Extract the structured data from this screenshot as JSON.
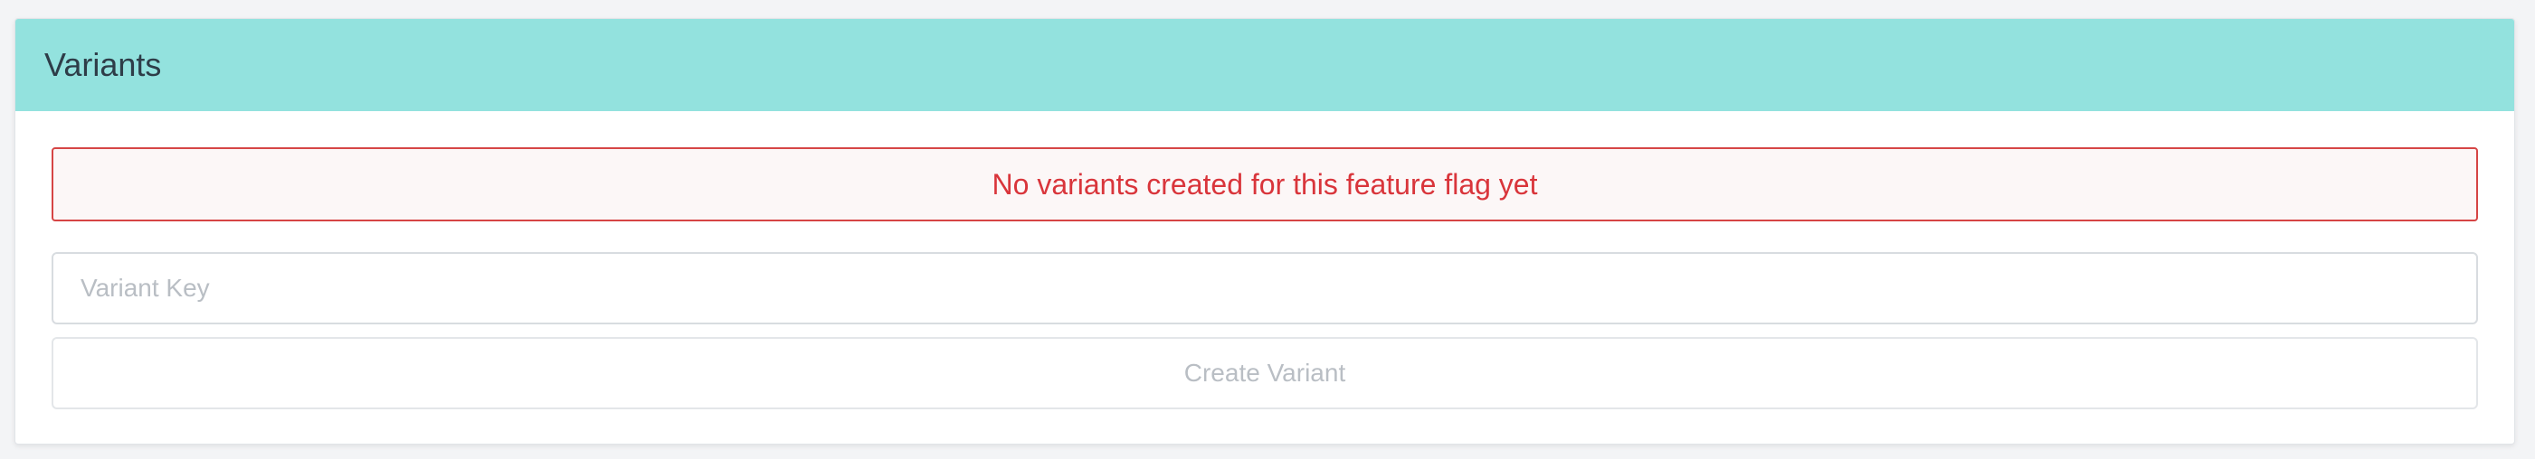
{
  "panel": {
    "title": "Variants"
  },
  "alert": {
    "message": "No variants created for this feature flag yet",
    "color": "#d9353b"
  },
  "variant_form": {
    "key_placeholder": "Variant Key",
    "key_value": "",
    "create_label": "Create Variant",
    "create_disabled": true
  },
  "colors": {
    "header_bg": "#93e2de",
    "alert_border": "#d64545"
  }
}
